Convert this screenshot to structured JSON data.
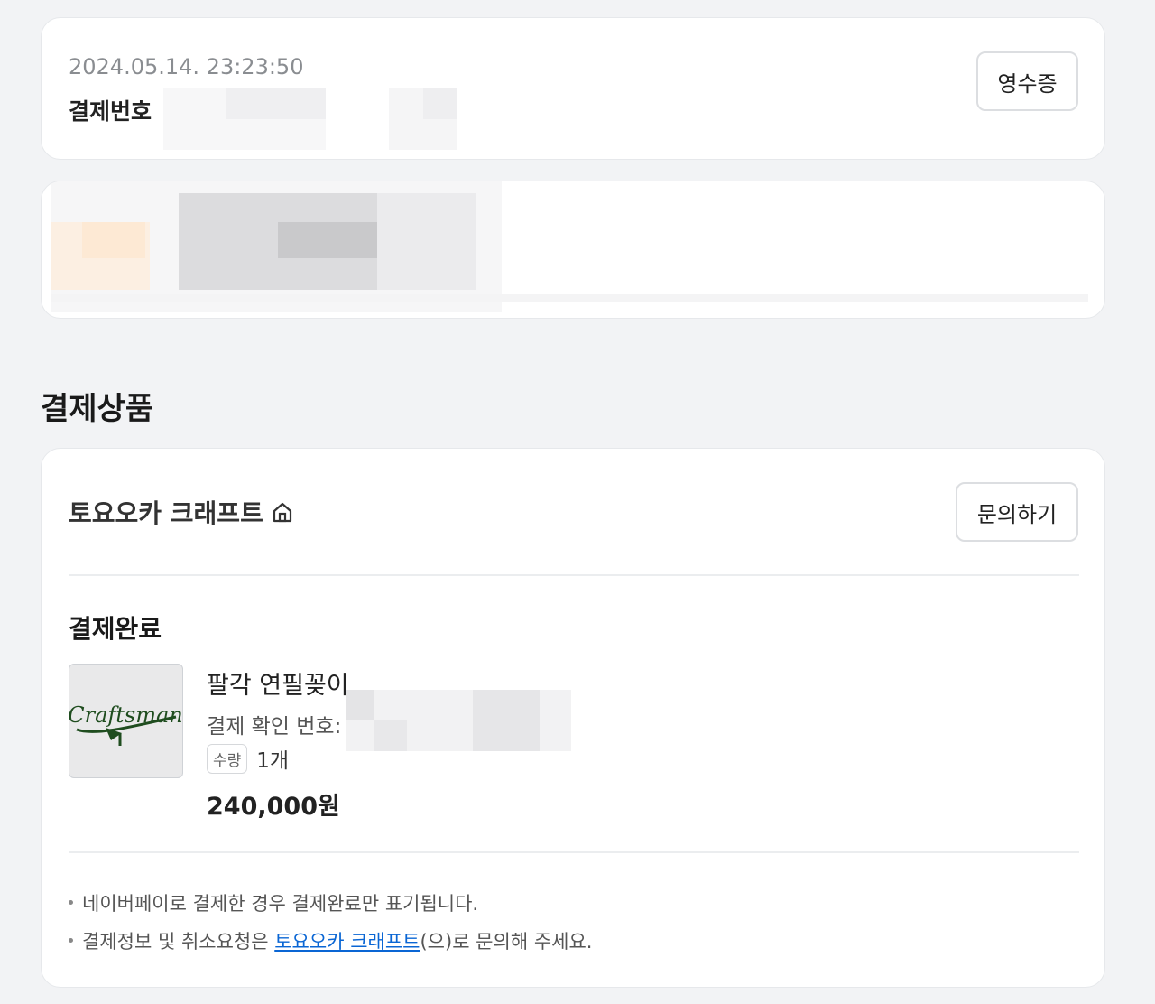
{
  "order": {
    "datetime": "2024.05.14. 23:23:50",
    "number_label": "결제번호",
    "receipt_button": "영수증"
  },
  "section_title": "결제상품",
  "store": {
    "name": "토요오카 크래프트",
    "home_icon": "home-icon",
    "inquiry_button": "문의하기"
  },
  "item": {
    "status": "결제완료",
    "thumbnail_text": "Craftsman",
    "name": "팔각 연필꽂이",
    "confirm_label": "결제 확인 번호:",
    "quantity_badge": "수량",
    "quantity": "1개",
    "price": "240,000원"
  },
  "notes": {
    "line1": "네이버페이로 결제한 경우 결제완료만 표기됩니다.",
    "line2_prefix": "결제정보 및 취소요청은 ",
    "line2_link": "토요오카 크래프트",
    "line2_suffix": "(으)로 문의해 주세요."
  },
  "colors": {
    "background": "#f2f3f5",
    "link": "#0a66d4",
    "logo_green": "#1f4d1f"
  }
}
